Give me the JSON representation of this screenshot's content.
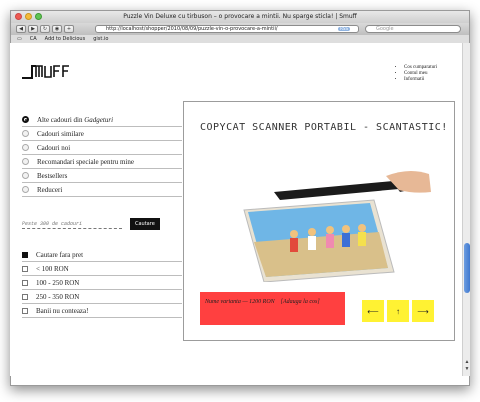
{
  "window": {
    "title": "Puzzle Vin Deluxe cu tirbuson – o provocare a mintii. Nu sparge sticla! | Smuff"
  },
  "toolbar": {
    "url": "http://localhost/shopper/2010/08/09/puzzle-vin-o-provocare-a-mintii/",
    "rss_label": "RSS",
    "search_placeholder": "Google",
    "back_icon": "back-arrow-icon",
    "forward_icon": "forward-arrow-icon"
  },
  "bookmarks": {
    "items": [
      "CA",
      "Add to Delicious",
      "gist.io"
    ]
  },
  "site": {
    "account_links": [
      "Cos cumparaturi",
      "Contul meu",
      "Informatii"
    ]
  },
  "menu": {
    "items": [
      {
        "label": "Alte cadouri din ",
        "emphasis": "Gadgeturi",
        "selected": true
      },
      {
        "label": "Cadouri similare",
        "selected": false
      },
      {
        "label": "Cadouri noi",
        "selected": false
      },
      {
        "label": "Recomandari speciale pentru mine",
        "selected": false
      },
      {
        "label": "Bestsellers",
        "selected": false
      },
      {
        "label": "Reduceri",
        "selected": false
      }
    ]
  },
  "search": {
    "placeholder": "Peste 300 de cadouri",
    "button_label": "Cautare"
  },
  "filters": {
    "items": [
      {
        "label": "Cautare fara pret",
        "selected": true
      },
      {
        "label": "< 100 RON",
        "selected": false
      },
      {
        "label": "100 - 250 RON",
        "selected": false
      },
      {
        "label": "250 - 350 RON",
        "selected": false
      },
      {
        "label": "Banii nu conteaza!",
        "selected": false
      }
    ]
  },
  "product": {
    "title": "COPYCAT SCANNER PORTABIL - SCANTASTIC!",
    "price_text": "Nume varianta — 1200 RON",
    "add_to_cart": "[Adauga la cos]",
    "nav": [
      "⟵",
      "↑",
      "⟶"
    ]
  },
  "colors": {
    "price_box": "#ff4040",
    "nav_buttons": "#fff233",
    "scroll_thumb": "#4f86d6"
  }
}
